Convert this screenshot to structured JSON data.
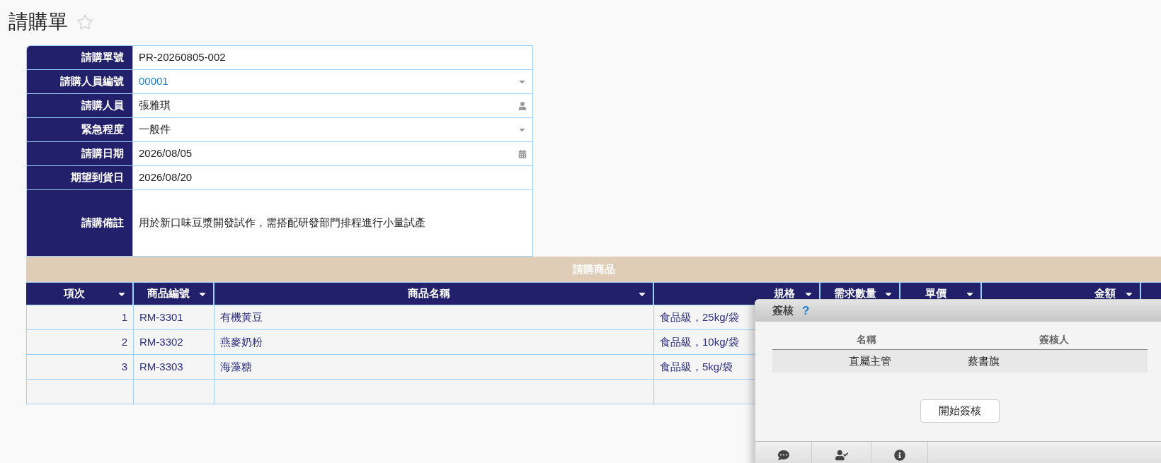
{
  "title": "請購單",
  "favorite": false,
  "form": [
    {
      "label": "請購單號",
      "value": "PR-20260805-002",
      "kind": "text",
      "link": false
    },
    {
      "label": "請購人員編號",
      "value": "00001",
      "kind": "select",
      "link": true
    },
    {
      "label": "請購人員",
      "value": "張雅琪",
      "kind": "person",
      "link": false
    },
    {
      "label": "緊急程度",
      "value": "一般件",
      "kind": "select",
      "link": false
    },
    {
      "label": "請購日期",
      "value": "2026/08/05",
      "kind": "date",
      "link": false
    },
    {
      "label": "期望到貨日",
      "value": "2026/08/20",
      "kind": "text",
      "link": false
    },
    {
      "label": "請購備註",
      "value": "用於新口味豆漿開發試作，需搭配研發部門排程進行小量試產",
      "kind": "memo",
      "link": false
    }
  ],
  "items_section": {
    "title": "請購商品",
    "columns": [
      "項次",
      "商品編號",
      "商品名稱",
      "規格",
      "需求數量",
      "單價",
      "金額"
    ],
    "rows": [
      [
        "1",
        "RM-3301",
        "有機黃豆",
        "食品級，25kg/袋"
      ],
      [
        "2",
        "RM-3302",
        "燕麥奶粉",
        "食品級，10kg/袋"
      ],
      [
        "3",
        "RM-3303",
        "海藻糖",
        "食品級，5kg/袋"
      ],
      []
    ]
  },
  "approval_panel": {
    "title": "簽核",
    "help": "?",
    "columns": [
      "名稱",
      "簽核人"
    ],
    "rows": [
      [
        "直屬主管",
        "蔡書旗"
      ]
    ],
    "button": "開始簽核"
  }
}
